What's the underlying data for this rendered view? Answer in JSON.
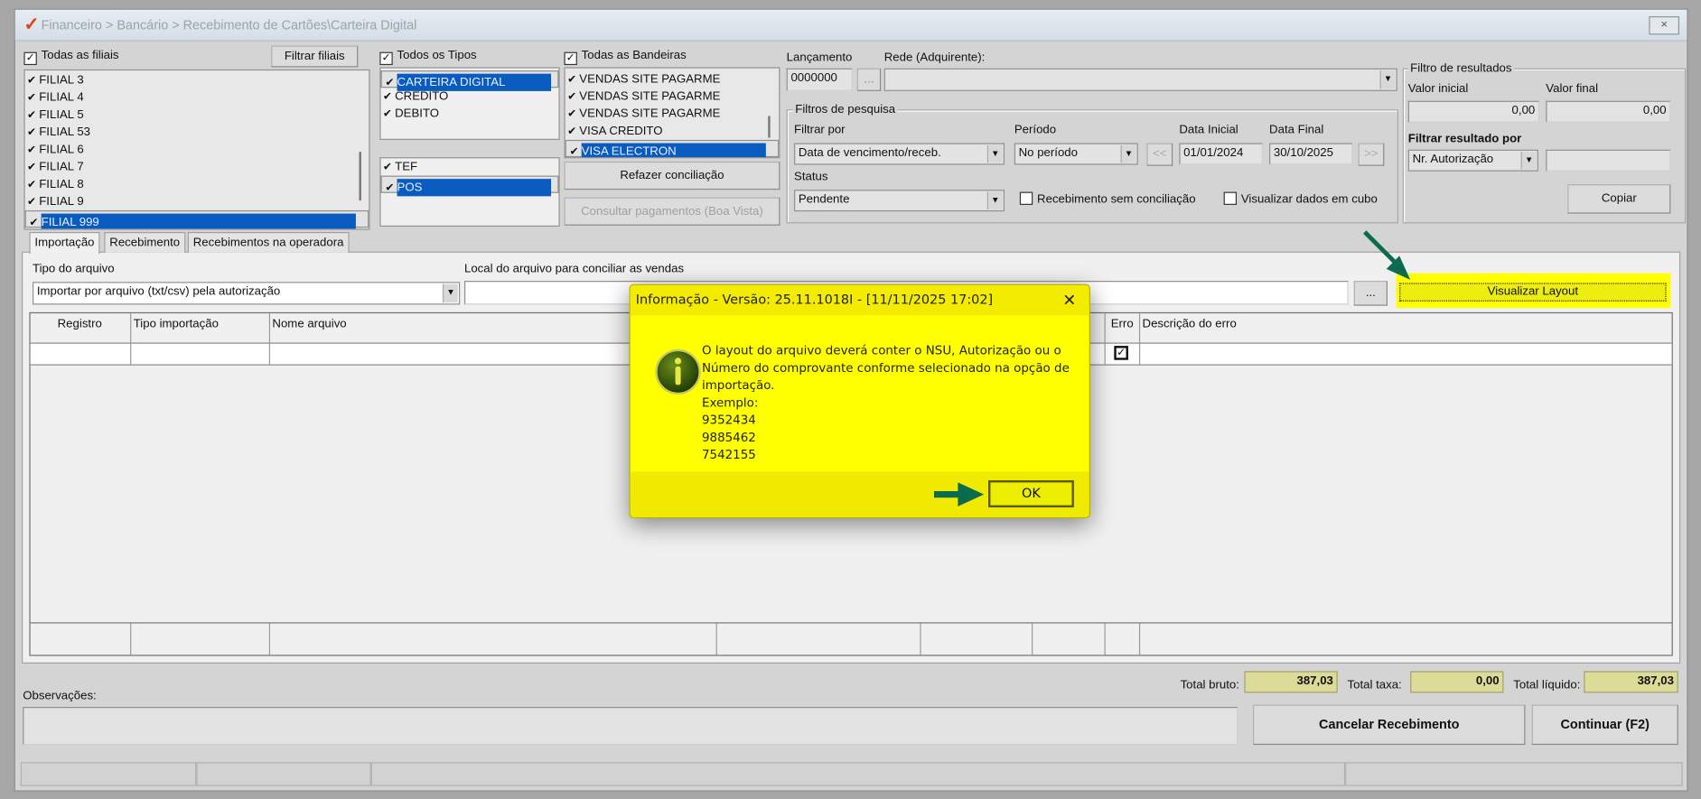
{
  "window": {
    "title": "Financeiro > Bancário > Recebimento de Cartões\\Carteira Digital",
    "close": "×"
  },
  "filiais": {
    "all_label": "Todas as filiais",
    "filter_button": "Filtrar filiais",
    "items": [
      "FILIAL 3",
      "FILIAL 4",
      "FILIAL 5",
      "FILIAL 53",
      "FILIAL 6",
      "FILIAL 7",
      "FILIAL 8",
      "FILIAL 9",
      "FILIAL 999"
    ]
  },
  "tipos": {
    "all_label": "Todos os Tipos",
    "items": [
      "CARTEIRA DIGITAL",
      "CREDITO",
      "DEBITO"
    ],
    "items2": [
      "TEF",
      "POS"
    ]
  },
  "bandeiras": {
    "all_label": "Todas as Bandeiras",
    "items": [
      "VENDAS SITE PAGARME",
      "VENDAS SITE PAGARME",
      "VENDAS SITE PAGARME",
      "VISA CREDITO",
      "VISA ELECTRON"
    ]
  },
  "buttons": {
    "refazer": "Refazer conciliação",
    "consultar": "Consultar pagamentos (Boa Vista)",
    "ellipsis": "...",
    "copiar": "Copiar",
    "visualizar": "Visualizar Layout",
    "cancelar": "Cancelar Recebimento",
    "continuar": "Continuar (F2)",
    "prev": "<<",
    "next": ">>"
  },
  "lancamento": {
    "label": "Lançamento",
    "value": "0000000"
  },
  "rede": {
    "label": "Rede (Adquirente):",
    "value": ""
  },
  "filtros": {
    "group": "Filtros de pesquisa",
    "filtrar_por_label": "Filtrar por",
    "filtrar_por": "Data de vencimento/receb.",
    "periodo_label": "Período",
    "periodo": "No período",
    "data_inicial_label": "Data Inicial",
    "data_inicial": "01/01/2024",
    "data_final_label": "Data Final",
    "data_final": "30/10/2025",
    "status_label": "Status",
    "status": "Pendente",
    "sem_conciliacao": "Recebimento sem conciliação",
    "cubo": "Visualizar dados em cubo"
  },
  "resultados": {
    "group": "Filtro de resultados",
    "valor_inicial_label": "Valor inicial",
    "valor_inicial": "0,00",
    "valor_final_label": "Valor final",
    "valor_final": "0,00",
    "filtrar_por_label": "Filtrar resultado por",
    "filtrar_por": "Nr. Autorização",
    "filtrar_valor": ""
  },
  "tabs": [
    "Importação",
    "Recebimento",
    "Recebimentos na operadora"
  ],
  "importacao": {
    "tipo_label": "Tipo do arquivo",
    "tipo": "Importar por arquivo (txt/csv) pela autorização",
    "local_label": "Local do arquivo para conciliar as vendas",
    "local": ""
  },
  "grid": {
    "headers": [
      "Registro",
      "Tipo importação",
      "Nome arquivo",
      "Erro",
      "Descrição do erro"
    ]
  },
  "totais": {
    "bruto_label": "Total bruto:",
    "bruto": "387,03",
    "taxa_label": "Total taxa:",
    "taxa": "0,00",
    "liquido_label": "Total líquido:",
    "liquido": "387,03"
  },
  "observacoes": {
    "label": "Observações:",
    "value": ""
  },
  "dialog": {
    "title": "Informação - Versão: 25.11.1018I - [11/11/2025 17:02]",
    "close": "✕",
    "lines": [
      "O layout do arquivo deverá conter o NSU, Autorização ou o",
      "Número do comprovante conforme selecionado na opção de",
      "importação.",
      "Exemplo:",
      "9352434",
      "9885462",
      "7542155"
    ],
    "ok": "OK"
  },
  "colors": {
    "highlight": "#ffff00",
    "arrow": "#0b6b4f",
    "selection": "#0a5bbf",
    "totals": "#dcdc98"
  }
}
